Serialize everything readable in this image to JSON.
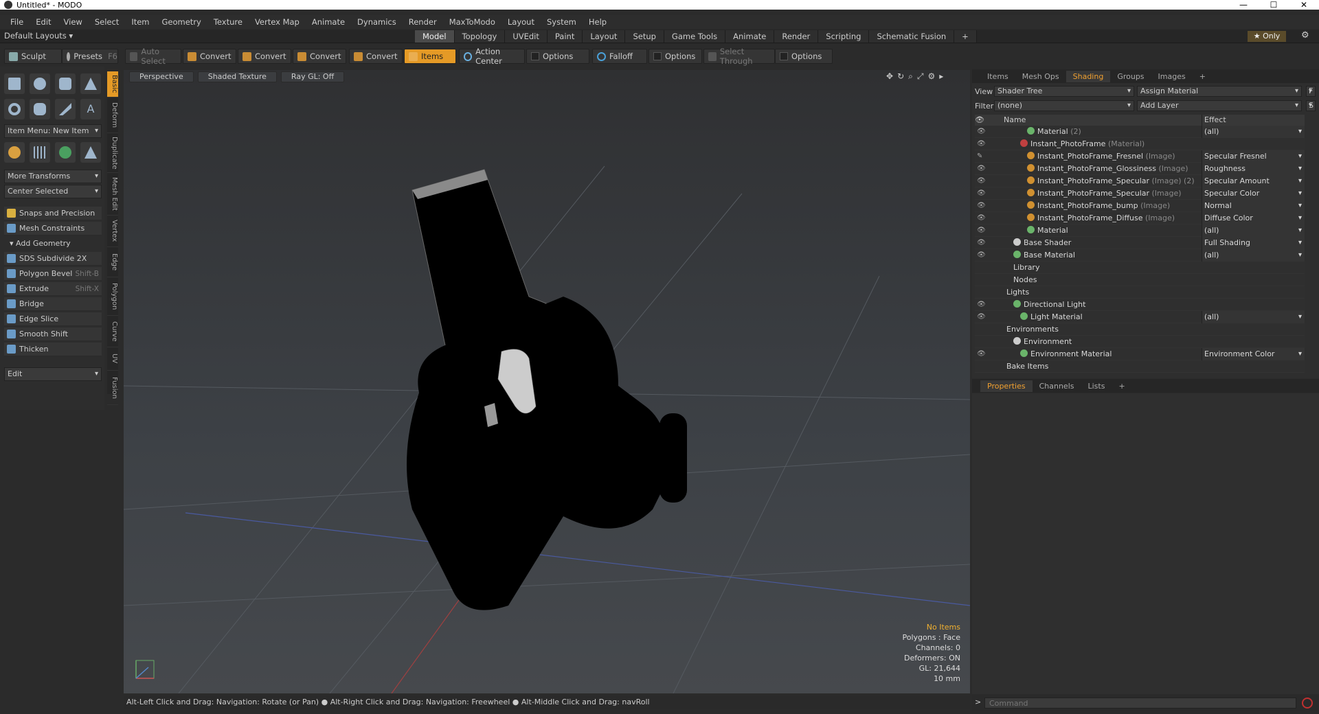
{
  "window": {
    "title": "Untitled* - MODO",
    "min": "—",
    "max": "☐",
    "close": "✕"
  },
  "menu": [
    "File",
    "Edit",
    "View",
    "Select",
    "Item",
    "Geometry",
    "Texture",
    "Vertex Map",
    "Animate",
    "Dynamics",
    "Render",
    "MaxToModo",
    "Layout",
    "System",
    "Help"
  ],
  "layouts": {
    "label": "Default Layouts ▾"
  },
  "tabs": [
    "Model",
    "Topology",
    "UVEdit",
    "Paint",
    "Layout",
    "Setup",
    "Game Tools",
    "Animate",
    "Render",
    "Scripting",
    "Schematic Fusion",
    "+"
  ],
  "only": "★  Only",
  "toolbar": {
    "sculpt": "Sculpt",
    "presets": "Presets",
    "presets_key": "F6",
    "autoselect": "Auto Select",
    "convert": "Convert",
    "items": "Items",
    "action_center": "Action Center",
    "options": "Options",
    "falloff": "Falloff",
    "select_through": "Select Through"
  },
  "sidebar": {
    "item_menu": "Item Menu: New Item",
    "more_transforms": "More Transforms",
    "center_selected": "Center Selected",
    "snaps": "Snaps and Precision",
    "mesh_constraints": "Mesh Constraints",
    "add_geometry": "Add Geometry",
    "tools": [
      {
        "label": "SDS Subdivide 2X",
        "key": ""
      },
      {
        "label": "Polygon Bevel",
        "key": "Shift-B"
      },
      {
        "label": "Extrude",
        "key": "Shift-X"
      },
      {
        "label": "Bridge",
        "key": ""
      },
      {
        "label": "Edge Slice",
        "key": ""
      },
      {
        "label": "Smooth Shift",
        "key": ""
      },
      {
        "label": "Thicken",
        "key": ""
      }
    ],
    "edit": "Edit"
  },
  "vtabs": [
    "Basic",
    "Deform",
    "Duplicate",
    "Mesh Edit",
    "Vertex",
    "Edge",
    "Polygon",
    "Curve",
    "UV",
    "Fusion"
  ],
  "viewport": {
    "perspective": "Perspective",
    "shading": "Shaded Texture",
    "raygl": "Ray GL: Off",
    "stats": {
      "noitems": "No Items",
      "polygons": "Polygons : Face",
      "channels": "Channels: 0",
      "deformers": "Deformers: ON",
      "gl": "GL: 21,644",
      "unit": "10 mm"
    }
  },
  "status": "Alt-Left Click and Drag: Navigation: Rotate (or Pan) ● Alt-Right Click and Drag: Navigation: Freewheel ● Alt-Middle Click and Drag: navRoll",
  "rpanel": {
    "tabs": [
      "Items",
      "Mesh Ops",
      "Shading",
      "Groups",
      "Images",
      "+"
    ],
    "view_label": "View",
    "view_value": "Shader Tree",
    "assign": "Assign Material",
    "f": "F",
    "filter_label": "Filter",
    "filter_value": "(none)",
    "add_layer": "Add Layer",
    "s": "S",
    "col_name": "Name",
    "col_effect": "Effect",
    "rows": [
      {
        "indent": 56,
        "name": "Material",
        "type": "(2)",
        "effect": "(all)",
        "eye": "👁"
      },
      {
        "indent": 46,
        "name": "Instant_PhotoFrame",
        "type": "(Material)",
        "effect": "",
        "eye": "👁"
      },
      {
        "indent": 56,
        "name": "Instant_PhotoFrame_Fresnel",
        "type": "(Image)",
        "effect": "Specular Fresnel",
        "eye": "✎"
      },
      {
        "indent": 56,
        "name": "Instant_PhotoFrame_Glossiness",
        "type": "(Image)",
        "effect": "Roughness",
        "eye": "👁"
      },
      {
        "indent": 56,
        "name": "Instant_PhotoFrame_Specular",
        "type": "(Image) (2)",
        "effect": "Specular Amount",
        "eye": "👁"
      },
      {
        "indent": 56,
        "name": "Instant_PhotoFrame_Specular",
        "type": "(Image)",
        "effect": "Specular Color",
        "eye": "👁"
      },
      {
        "indent": 56,
        "name": "Instant_PhotoFrame_bump",
        "type": "(Image)",
        "effect": "Normal",
        "eye": "👁"
      },
      {
        "indent": 56,
        "name": "Instant_PhotoFrame_Diffuse",
        "type": "(Image)",
        "effect": "Diffuse Color",
        "eye": "👁"
      },
      {
        "indent": 56,
        "name": "Material",
        "type": "",
        "effect": "(all)",
        "eye": "👁"
      },
      {
        "indent": 36,
        "name": "Base Shader",
        "type": "",
        "effect": "Full Shading",
        "eye": "👁"
      },
      {
        "indent": 36,
        "name": "Base Material",
        "type": "",
        "effect": "(all)",
        "eye": "👁"
      },
      {
        "indent": 36,
        "name": "Library",
        "type": "",
        "effect": "",
        "eye": ""
      },
      {
        "indent": 36,
        "name": "Nodes",
        "type": "",
        "effect": "",
        "eye": ""
      },
      {
        "indent": 26,
        "name": "Lights",
        "type": "",
        "effect": "",
        "eye": ""
      },
      {
        "indent": 36,
        "name": "Directional Light",
        "type": "",
        "effect": "",
        "eye": "👁"
      },
      {
        "indent": 46,
        "name": "Light Material",
        "type": "",
        "effect": "(all)",
        "eye": "👁"
      },
      {
        "indent": 26,
        "name": "Environments",
        "type": "",
        "effect": "",
        "eye": ""
      },
      {
        "indent": 36,
        "name": "Environment",
        "type": "",
        "effect": "",
        "eye": ""
      },
      {
        "indent": 46,
        "name": "Environment Material",
        "type": "",
        "effect": "Environment Color",
        "eye": "👁"
      },
      {
        "indent": 26,
        "name": "Bake Items",
        "type": "",
        "effect": "",
        "eye": ""
      }
    ]
  },
  "properties": {
    "tabs": [
      "Properties",
      "Channels",
      "Lists",
      "+"
    ]
  },
  "command": {
    "placeholder": "Command"
  },
  "colors": {
    "accent": "#e59a26",
    "selected_tab": "#f0a030"
  }
}
